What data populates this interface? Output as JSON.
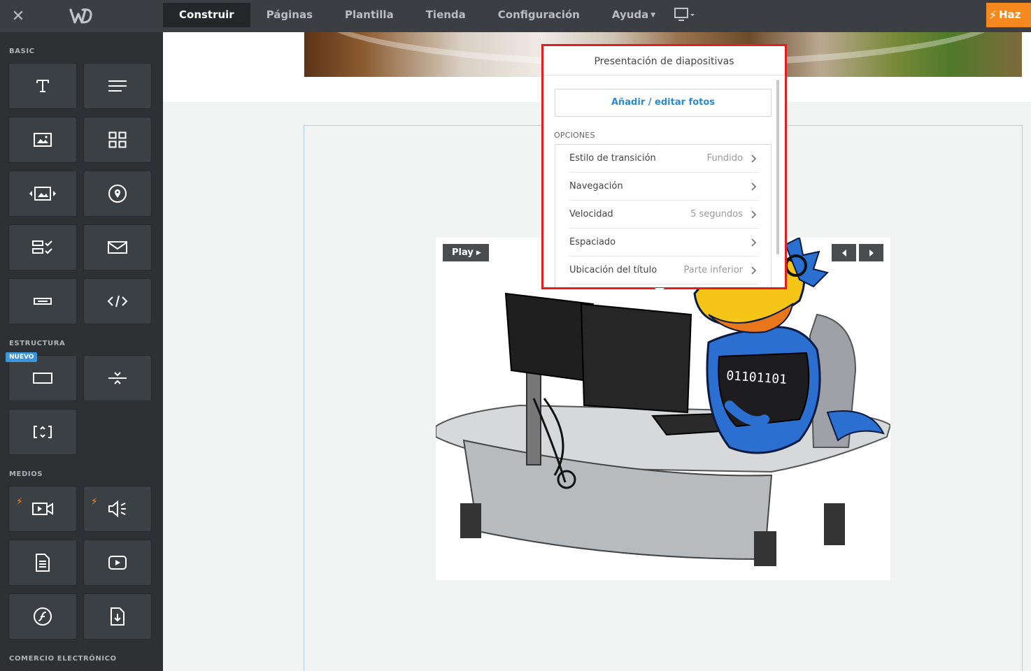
{
  "topbar": {
    "tabs": [
      {
        "label": "Construir"
      },
      {
        "label": "Páginas"
      },
      {
        "label": "Plantilla"
      },
      {
        "label": "Tienda"
      },
      {
        "label": "Configuración"
      },
      {
        "label": "Ayuda"
      }
    ],
    "publish_label": "Haz"
  },
  "sidebar": {
    "sections": {
      "basic": "BASIC",
      "estructura": "ESTRUCTURA",
      "medios": "MEDIOS",
      "comercio": "COMERCIO ELECTRÓNICO"
    },
    "nuevo_badge": "NUEVO"
  },
  "slideshow": {
    "play_label": "Play"
  },
  "popover": {
    "title": "Presentación de diapositivas",
    "add_photos_label": "Añadir / editar fotos",
    "options_label": "OPCIONES",
    "options": [
      {
        "label": "Estilo de transición",
        "value": "Fundido"
      },
      {
        "label": "Navegación",
        "value": ""
      },
      {
        "label": "Velocidad",
        "value": "5 segundos"
      },
      {
        "label": "Espaciado",
        "value": ""
      },
      {
        "label": "Ubicación del título",
        "value": "Parte inferior"
      }
    ]
  },
  "colors": {
    "accent_orange": "#f5891f",
    "link_blue": "#2a8bd1",
    "highlight_red": "#e02020"
  }
}
